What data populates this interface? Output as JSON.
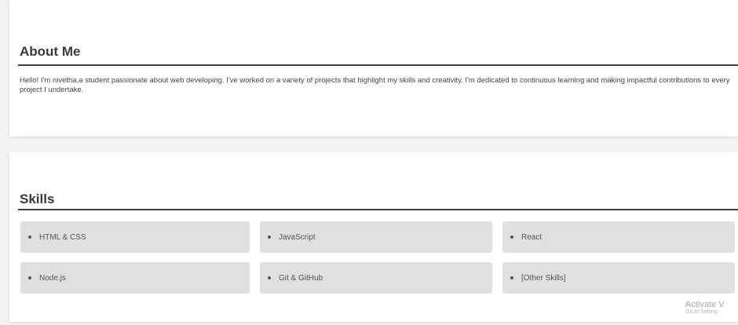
{
  "about": {
    "title": "About Me",
    "text": "Hello! I'm nivetha,a student passionate about web developing. I've worked on a variety of projects that highlight my skills and creativity. I'm dedicated to continuous learning and making impactful contributions to every project I undertake."
  },
  "skills": {
    "title": "Skills",
    "items": [
      {
        "label": "HTML & CSS"
      },
      {
        "label": "JavaScript"
      },
      {
        "label": "React"
      },
      {
        "label": "Node.js"
      },
      {
        "label": "Git & GitHub"
      },
      {
        "label": "[Other Skills]"
      }
    ]
  },
  "watermark": {
    "line1": "Activate V",
    "line2": "Go to Setting"
  }
}
